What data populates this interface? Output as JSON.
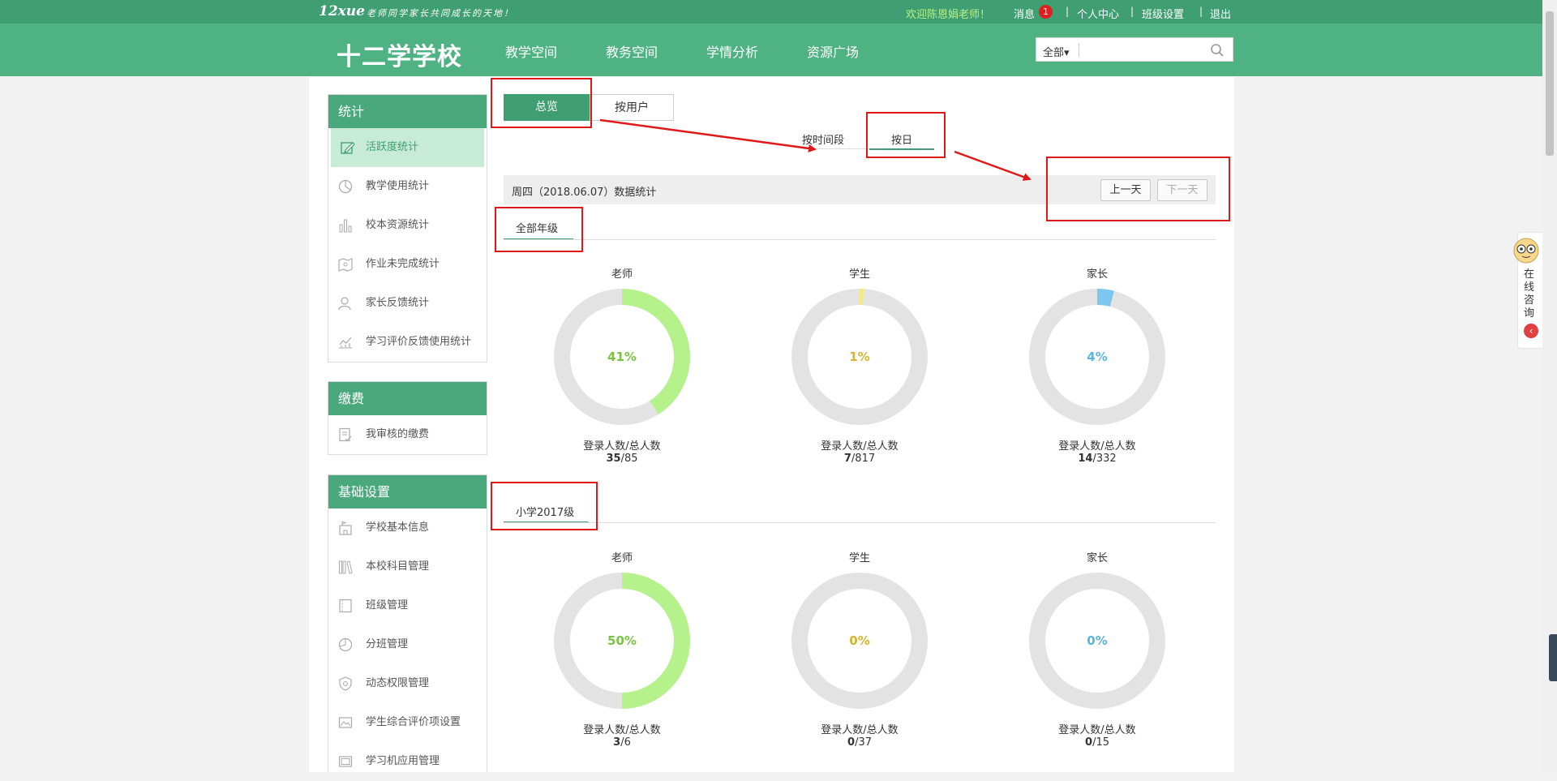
{
  "topbar": {
    "logo": "12xue",
    "slogan": "老师同学家长共同成长的天地！",
    "welcome": "欢迎陈恩娟老师！",
    "messages_label": "消息",
    "messages_count": "1",
    "links": [
      "个人中心",
      "班级设置",
      "退出"
    ]
  },
  "nav": {
    "brand": "十二学学校",
    "items": [
      "教学空间",
      "教务空间",
      "学情分析",
      "资源广场"
    ]
  },
  "search": {
    "scope": "全部▾",
    "placeholder": ""
  },
  "sidebar": {
    "stats": {
      "title": "统计",
      "items": [
        "活跃度统计",
        "教学使用统计",
        "校本资源统计",
        "作业未完成统计",
        "家长反馈统计",
        "学习评价反馈使用统计"
      ]
    },
    "fee": {
      "title": "缴费",
      "items": [
        "我审核的缴费"
      ]
    },
    "basic": {
      "title": "基础设置",
      "items": [
        "学校基本信息",
        "本校科目管理",
        "班级管理",
        "分班管理",
        "动态权限管理",
        "学生综合评价项设置",
        "学习机应用管理"
      ]
    }
  },
  "tabs": {
    "overview": "总览",
    "by_user": "按用户",
    "by_period": "按时间段",
    "by_day": "按日"
  },
  "date_bar": {
    "label": "周四（2018.06.07）数据统计",
    "prev": "上一天",
    "next": "下一天"
  },
  "groups": [
    {
      "name": "全部年级",
      "stats": [
        {
          "title": "老师",
          "pct": "41%",
          "value": 0.41,
          "label": "登录人数/总人数",
          "logged": "35",
          "total": "/85",
          "color": "#b6f28c",
          "text_color": "#7cc242"
        },
        {
          "title": "学生",
          "pct": "1%",
          "value": 0.01,
          "label": "登录人数/总人数",
          "logged": "7",
          "total": "/817",
          "color": "#f2ea80",
          "text_color": "#d4b62c"
        },
        {
          "title": "家长",
          "pct": "4%",
          "value": 0.04,
          "label": "登录人数/总人数",
          "logged": "14",
          "total": "/332",
          "color": "#7cc7ee",
          "text_color": "#5ab4e0"
        }
      ]
    },
    {
      "name": "小学2017级",
      "stats": [
        {
          "title": "老师",
          "pct": "50%",
          "value": 0.5,
          "label": "登录人数/总人数",
          "logged": "3",
          "total": "/6",
          "color": "#b6f28c",
          "text_color": "#7cc242"
        },
        {
          "title": "学生",
          "pct": "0%",
          "value": 0,
          "label": "登录人数/总人数",
          "logged": "0",
          "total": "/37",
          "color": "#f2ea80",
          "text_color": "#d4b62c"
        },
        {
          "title": "家长",
          "pct": "0%",
          "value": 0,
          "label": "登录人数/总人数",
          "logged": "0",
          "total": "/15",
          "color": "#7cc7ee",
          "text_color": "#5ab4e0"
        }
      ]
    }
  ],
  "consult": {
    "label": "在线咨询"
  },
  "colors": {
    "brand_dark": "#3f9e72",
    "brand": "#4fb283",
    "annotation": "#e01818"
  }
}
